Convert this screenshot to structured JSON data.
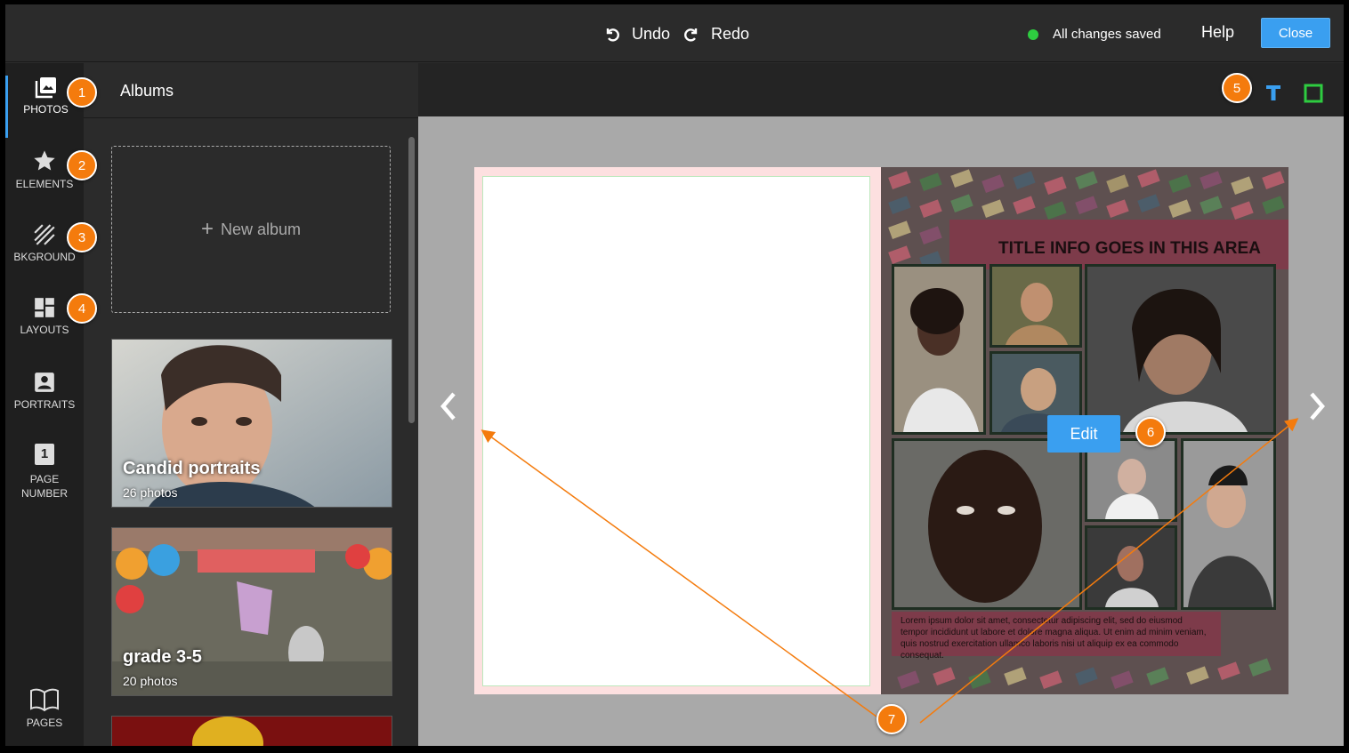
{
  "topbar": {
    "undo_label": "Undo",
    "redo_label": "Redo",
    "save_status": "All changes saved",
    "help_label": "Help",
    "close_label": "Close"
  },
  "rail": {
    "photos": "PHOTOS",
    "elements": "ELEMENTS",
    "background": "BKGROUND",
    "layouts": "LAYOUTS",
    "portraits": "PORTRAITS",
    "page_number_1": "PAGE",
    "page_number_2": "NUMBER",
    "page_number_icon": "1",
    "pages": "PAGES"
  },
  "panel": {
    "title": "Albums",
    "new_album": "New album",
    "albums": [
      {
        "name": "Candid portraits",
        "count": "26 photos"
      },
      {
        "name": "grade 3-5",
        "count": "20 photos"
      }
    ]
  },
  "canvas": {
    "page_title": "TITLE INFO GOES IN THIS AREA",
    "lorem": "Lorem ipsum dolor sit amet, consectetur adipiscing elit, sed do eiusmod tempor incididunt ut labore et dolore magna aliqua. Ut enim ad minim veniam, quis nostrud exercitation ullamco laboris nisi ut aliquip ex ea commodo consequat.",
    "edit_label": "Edit"
  },
  "callouts": [
    "1",
    "2",
    "3",
    "4",
    "5",
    "6",
    "7"
  ],
  "colors": {
    "accent": "#3a9ff0",
    "callout": "#f47b0d",
    "saved": "#2ecc40"
  }
}
